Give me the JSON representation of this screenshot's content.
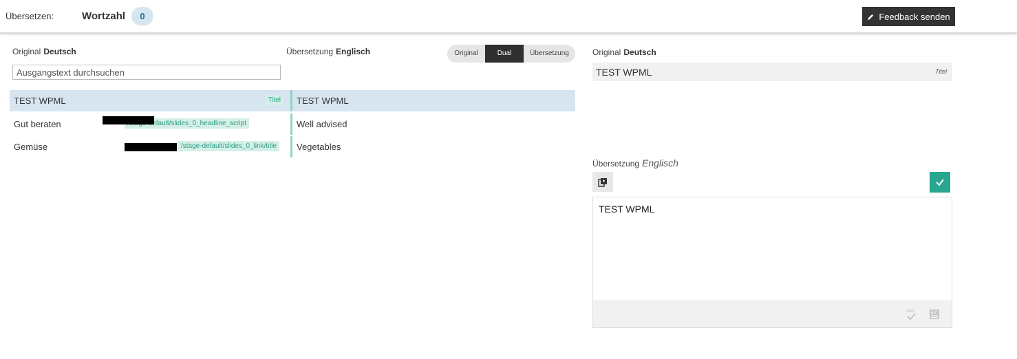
{
  "topbar": {
    "translate_label": "Übersetzen:",
    "word_count_label": "Wortzahl",
    "word_count": "0",
    "feedback_label": "Feedback senden"
  },
  "left": {
    "original_label": "Original",
    "original_lang": "Deutsch",
    "translation_label": "Übersetzung",
    "translation_lang": "Englisch",
    "search_placeholder": "Ausgangstext durchsuchen",
    "view_toggle": {
      "original": "Original",
      "dual": "Dual",
      "translation": "Übersetzung",
      "selected": "Dual"
    },
    "rows": [
      {
        "source": "TEST WPML",
        "tag": "Titel",
        "target": "TEST WPML",
        "selected": true
      },
      {
        "source": "Gut beraten",
        "tag": "/stage-default/slides_0_headline_script",
        "target": "Well advised",
        "selected": false
      },
      {
        "source": "Gemüse",
        "tag": "/stage-default/slides_0_link/title",
        "target": "Vegetables",
        "selected": false
      }
    ]
  },
  "right": {
    "original_label": "Original",
    "original_lang": "Deutsch",
    "original_text": "TEST WPML",
    "original_kind": "Titel",
    "translation_label": "Übersetzung",
    "translation_lang": "Englisch",
    "translation_text": "TEST WPML",
    "icons": [
      "copy-original-icon",
      "check-icon",
      "spellcheck-icon",
      "glossary-icon"
    ]
  },
  "colors": {
    "accent": "#27a78f",
    "selected_row": "#d6e5f0",
    "tag_bg": "#d5efe7",
    "dark_button": "#333333"
  }
}
